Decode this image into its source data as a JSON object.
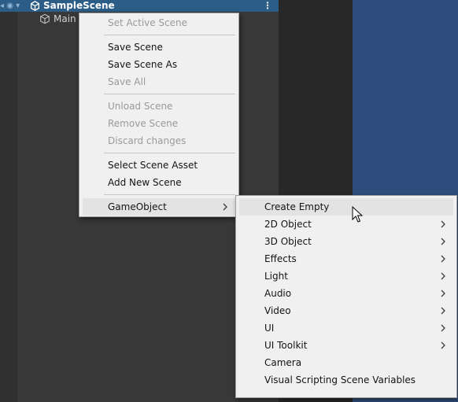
{
  "hierarchy": {
    "scene_name": "SampleScene",
    "child_name": "Main"
  },
  "context_menu": {
    "items": [
      {
        "label": "Set Active Scene",
        "disabled": true
      },
      {
        "label": "Save Scene",
        "disabled": false
      },
      {
        "label": "Save Scene As",
        "disabled": false
      },
      {
        "label": "Save All",
        "disabled": true
      },
      {
        "label": "Unload Scene",
        "disabled": true
      },
      {
        "label": "Remove Scene",
        "disabled": true
      },
      {
        "label": "Discard changes",
        "disabled": true
      },
      {
        "label": "Select Scene Asset",
        "disabled": false
      },
      {
        "label": "Add New Scene",
        "disabled": false
      },
      {
        "label": "GameObject",
        "disabled": false,
        "submenu": true
      }
    ]
  },
  "gameobject_submenu": {
    "items": [
      {
        "label": "Create Empty",
        "submenu": false
      },
      {
        "label": "2D Object",
        "submenu": true
      },
      {
        "label": "3D Object",
        "submenu": true
      },
      {
        "label": "Effects",
        "submenu": true
      },
      {
        "label": "Light",
        "submenu": true
      },
      {
        "label": "Audio",
        "submenu": true
      },
      {
        "label": "Video",
        "submenu": true
      },
      {
        "label": "UI",
        "submenu": true
      },
      {
        "label": "UI Toolkit",
        "submenu": true
      },
      {
        "label": "Camera",
        "submenu": false
      },
      {
        "label": "Visual Scripting Scene Variables",
        "submenu": false
      }
    ]
  },
  "colors": {
    "selection_row": "#2c5d87",
    "scene_view_blue": "#2e4d7c",
    "menu_bg": "#f0f0f0",
    "menu_highlight": "#e3e3e3"
  },
  "icons": {
    "scene": "unity-scene-icon",
    "gameobject": "cube-icon",
    "submenu": "chevron-right-icon",
    "options": "kebab-menu-icon"
  }
}
